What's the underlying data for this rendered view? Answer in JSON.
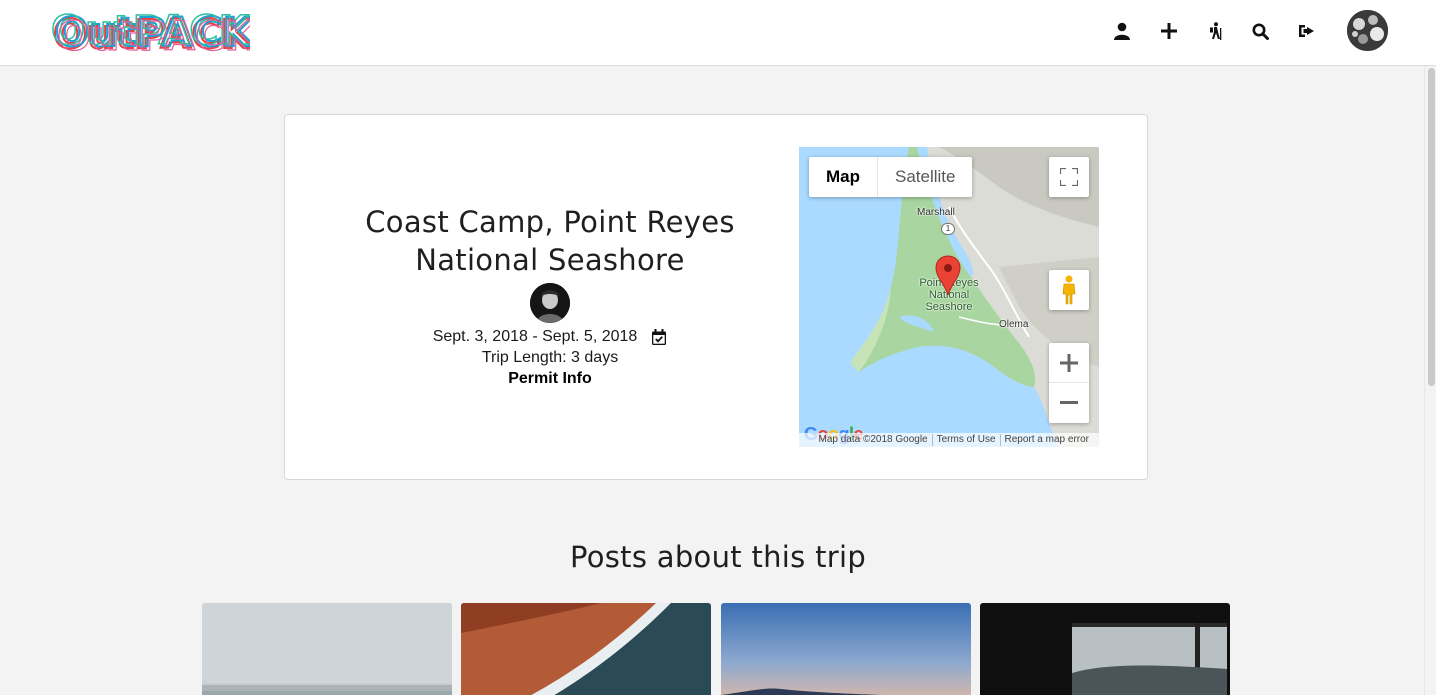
{
  "header": {
    "logo_text": "OutPACK",
    "nav_icons": [
      "user-icon",
      "plus-icon",
      "hiker-icon",
      "search-icon",
      "sign-out-icon"
    ]
  },
  "trip": {
    "title_line1": "Coast Camp, Point Reyes",
    "title_line2": "National Seashore",
    "dates": "Sept. 3, 2018 - Sept. 5, 2018",
    "trip_length": "Trip Length: 3 days",
    "permit_label": "Permit Info"
  },
  "map": {
    "type_map": "Map",
    "type_satellite": "Satellite",
    "labels": {
      "marshall": "Marshall",
      "route": "1",
      "place_line1": "Point Reyes",
      "place_line2": "National",
      "place_line3": "Seashore",
      "olema": "Olema"
    },
    "google": "Google",
    "footer_data": "Map data ©2018 Google",
    "footer_terms": "Terms of Use",
    "footer_report": "Report a map error"
  },
  "posts": {
    "heading": "Posts about this trip",
    "cards": [
      "foggy-beach-photo",
      "aerial-red-shore-photo",
      "coastal-dusk-photo",
      "window-view-photo"
    ]
  },
  "colors": {
    "page_bg": "#f3f3f3",
    "map_water": "#aadaff",
    "map_land": "#a8d5a0",
    "marker": "#ea4335"
  }
}
